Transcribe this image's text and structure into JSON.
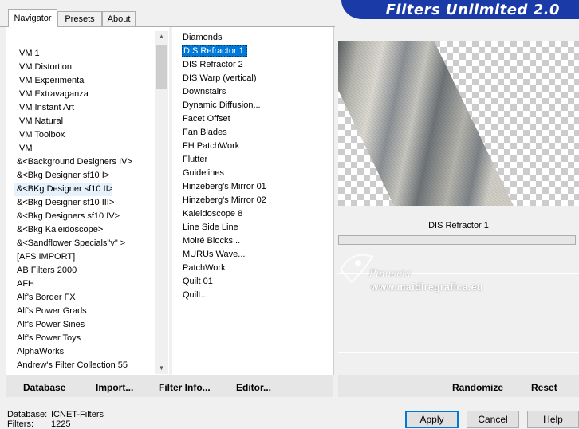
{
  "tabs": [
    {
      "label": "Navigator",
      "active": true
    },
    {
      "label": "Presets",
      "active": false
    },
    {
      "label": "About",
      "active": false
    }
  ],
  "banner": {
    "title": "Filters Unlimited 2.0",
    "color": "#1a3aa8"
  },
  "categories": [
    "VM 1",
    "VM Distortion",
    "VM Experimental",
    "VM Extravaganza",
    "VM Instant Art",
    "VM Natural",
    "VM Toolbox",
    "VM",
    "&<Background Designers IV>",
    "&<Bkg Designer sf10 I>",
    "&<BKg Designer sf10 II>",
    "&<Bkg Designer sf10 III>",
    "&<Bkg Designers sf10 IV>",
    "&<Bkg Kaleidoscope>",
    "&<Sandflower Specials\"v\" >",
    "[AFS IMPORT]",
    "AB Filters 2000",
    "AFH",
    "Alf's Border FX",
    "Alf's Power Grads",
    "Alf's Power Sines",
    "Alf's Power Toys",
    "AlphaWorks",
    "Andrew's Filter Collection 55"
  ],
  "selected_category": "&<BKg Designer sf10 II>",
  "filters": [
    "Diamonds",
    "DIS Refractor 1",
    "DIS Refractor 2",
    "DIS Warp (vertical)",
    "Downstairs",
    "Dynamic Diffusion...",
    "Facet Offset",
    "Fan Blades",
    "FH PatchWork",
    "Flutter",
    "Guidelines",
    "Hinzeberg's Mirror 01",
    "Hinzeberg's Mirror 02",
    "Kaleidoscope 8",
    "Line Side Line",
    "Moiré Blocks...",
    "MURUs Wave...",
    "PatchWork",
    "Quilt 01",
    "Quilt..."
  ],
  "selected_filter": "DIS Refractor 1",
  "filters_with_marker": [
    "DIS Refractor 2",
    "Flutter",
    "Guidelines"
  ],
  "toolbar": {
    "database_label": "Database",
    "import_label": "Import...",
    "filter_info_label": "Filter Info...",
    "editor_label": "Editor...",
    "randomize_label": "Randomize",
    "reset_label": "Reset"
  },
  "preview": {
    "filter_name": "DIS Refractor 1"
  },
  "watermark": {
    "name": "Pinuccia",
    "url": "www.maidiregrafica.eu"
  },
  "status": {
    "database_label": "Database:",
    "database_value": "ICNET-Filters",
    "filters_label": "Filters:",
    "filters_value": "1225"
  },
  "buttons": {
    "apply": "Apply",
    "cancel": "Cancel",
    "help": "Help"
  },
  "icons": {
    "scroll_up": "chevron-up-icon",
    "scroll_down": "chevron-down-icon"
  }
}
